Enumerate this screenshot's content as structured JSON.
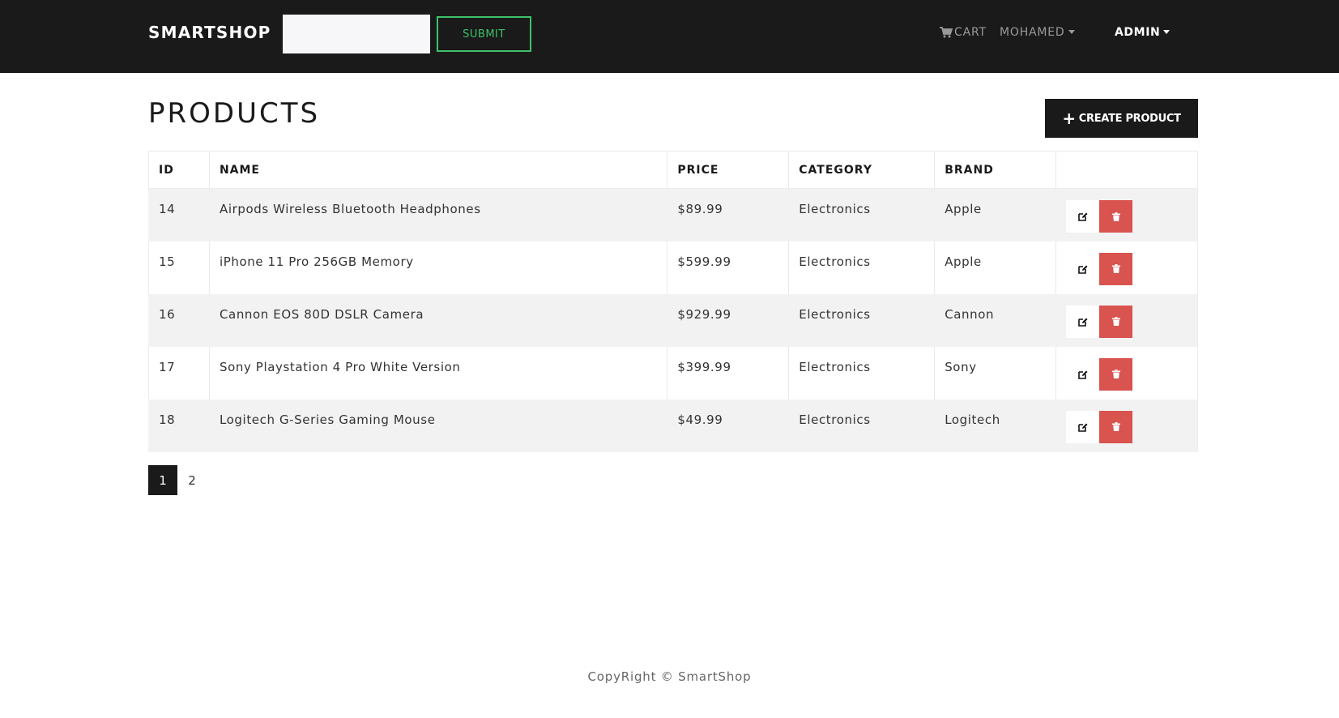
{
  "navbar": {
    "brand": "SMARTSHOP",
    "search_placeholder": "",
    "submit_label": "SUBMIT",
    "cart_label": "CART",
    "user_label": "MOHAMED",
    "admin_label": "ADMIN"
  },
  "page": {
    "title": "PRODUCTS",
    "create_label": "CREATE PRODUCT"
  },
  "table": {
    "columns": [
      "ID",
      "NAME",
      "PRICE",
      "CATEGORY",
      "BRAND",
      ""
    ],
    "rows": [
      {
        "id": "14",
        "name": "Airpods Wireless Bluetooth Headphones",
        "price": "$89.99",
        "category": "Electronics",
        "brand": "Apple"
      },
      {
        "id": "15",
        "name": "iPhone 11 Pro 256GB Memory",
        "price": "$599.99",
        "category": "Electronics",
        "brand": "Apple"
      },
      {
        "id": "16",
        "name": "Cannon EOS 80D DSLR Camera",
        "price": "$929.99",
        "category": "Electronics",
        "brand": "Cannon"
      },
      {
        "id": "17",
        "name": "Sony Playstation 4 Pro White Version",
        "price": "$399.99",
        "category": "Electronics",
        "brand": "Sony"
      },
      {
        "id": "18",
        "name": "Logitech G-Series Gaming Mouse",
        "price": "$49.99",
        "category": "Electronics",
        "brand": "Logitech"
      }
    ]
  },
  "pagination": {
    "pages": [
      "1",
      "2"
    ],
    "active": "1"
  },
  "footer": {
    "text": "CopyRight © SmartShop"
  },
  "colors": {
    "navbar_bg": "#1a1a1a",
    "submit_accent": "#3ec16a",
    "delete_red": "#d9534f",
    "stripe": "#f2f2f2"
  }
}
